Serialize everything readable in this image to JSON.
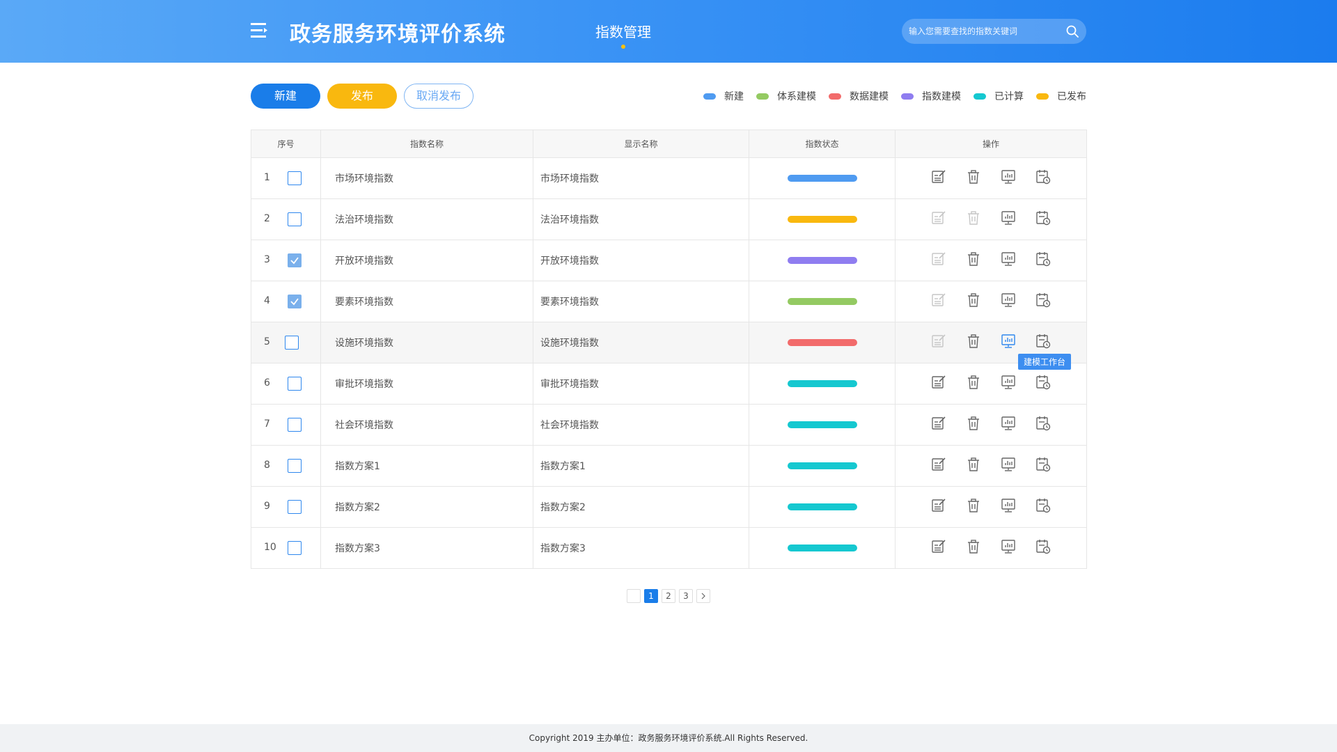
{
  "header": {
    "title": "政务服务环境评价系统",
    "nav_tab": "指数管理",
    "search_placeholder": "输入您需要查找的指数关键词"
  },
  "toolbar": {
    "new_label": "新建",
    "publish_label": "发布",
    "cancel_publish_label": "取消发布"
  },
  "legend": [
    {
      "label": "新建",
      "color": "#4f9bf1"
    },
    {
      "label": "体系建模",
      "color": "#94ca62"
    },
    {
      "label": "数据建模",
      "color": "#f26b6b"
    },
    {
      "label": "指数建模",
      "color": "#8f7df0"
    },
    {
      "label": "已计算",
      "color": "#15c8d0"
    },
    {
      "label": "已发布",
      "color": "#f9b80f"
    }
  ],
  "table": {
    "headers": [
      "序号",
      "指数名称",
      "显示名称",
      "指数状态",
      "操作"
    ],
    "rows": [
      {
        "idx": "1",
        "name": "市场环境指数",
        "display": "市场环境指数",
        "checked": false,
        "status_color": "#4f9bf1"
      },
      {
        "idx": "2",
        "name": "法治环境指数",
        "display": "法治环境指数",
        "checked": false,
        "status_color": "#f9b80f"
      },
      {
        "idx": "3",
        "name": "开放环境指数",
        "display": "开放环境指数",
        "checked": true,
        "status_color": "#8f7df0"
      },
      {
        "idx": "4",
        "name": "要素环境指数",
        "display": "要素环境指数",
        "checked": true,
        "status_color": "#94ca62"
      },
      {
        "idx": "5",
        "name": "设施环境指数",
        "display": "设施环境指数",
        "checked": false,
        "status_color": "#f26b6b"
      },
      {
        "idx": "6",
        "name": "审批环境指数",
        "display": "审批环境指数",
        "checked": false,
        "status_color": "#15c8d0"
      },
      {
        "idx": "7",
        "name": "社会环境指数",
        "display": "社会环境指数",
        "checked": false,
        "status_color": "#15c8d0"
      },
      {
        "idx": "8",
        "name": "指数方案1",
        "display": "指数方案1",
        "checked": false,
        "status_color": "#15c8d0"
      },
      {
        "idx": "9",
        "name": "指数方案2",
        "display": "指数方案2",
        "checked": false,
        "status_color": "#15c8d0"
      },
      {
        "idx": "10",
        "name": "指数方案3",
        "display": "指数方案3",
        "checked": false,
        "status_color": "#15c8d0"
      }
    ],
    "tooltip": "建模工作台"
  },
  "pagination": {
    "pages": [
      "1",
      "2",
      "3"
    ],
    "current": "1"
  },
  "footer": {
    "copyright": "Copyright 2019 主办单位：政务服务环境评价系统.All Rights Reserved."
  }
}
